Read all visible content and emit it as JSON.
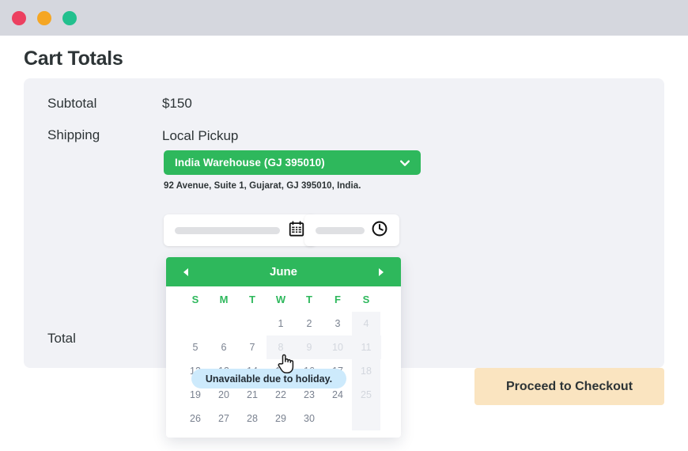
{
  "window": {
    "dots": [
      {
        "name": "close",
        "color": "#ec4060"
      },
      {
        "name": "minimize",
        "color": "#f5a623"
      },
      {
        "name": "maximize",
        "color": "#22c08e"
      }
    ]
  },
  "page": {
    "title": "Cart Totals"
  },
  "totals": {
    "subtotal_label": "Subtotal",
    "subtotal_value": "$150",
    "shipping_label": "Shipping",
    "shipping_method": "Local Pickup",
    "total_label": "Total"
  },
  "warehouse": {
    "selected": "India Warehouse (GJ 395010)",
    "chevron_icon": "chevron-down-icon",
    "address": "92 Avenue, Suite 1, Gujarat, GJ 395010, India.",
    "accent_color": "#2eb85c"
  },
  "fields": {
    "date": {
      "placeholder": "",
      "icon": "calendar-icon"
    },
    "time": {
      "placeholder": "",
      "icon": "clock-icon"
    }
  },
  "datepicker": {
    "month": "June",
    "prev_icon": "triangle-left-icon",
    "next_icon": "triangle-right-icon",
    "weekdays": [
      "S",
      "M",
      "T",
      "W",
      "T",
      "F",
      "S"
    ],
    "weeks": [
      [
        {
          "day": "",
          "state": "empty"
        },
        {
          "day": "",
          "state": "empty"
        },
        {
          "day": "",
          "state": "empty"
        },
        {
          "day": "1",
          "state": "available"
        },
        {
          "day": "2",
          "state": "available"
        },
        {
          "day": "3",
          "state": "available"
        },
        {
          "day": "4",
          "state": "disabled"
        }
      ],
      [
        {
          "day": "5",
          "state": "available"
        },
        {
          "day": "6",
          "state": "available"
        },
        {
          "day": "7",
          "state": "available"
        },
        {
          "day": "8",
          "state": "disabled"
        },
        {
          "day": "9",
          "state": "disabled"
        },
        {
          "day": "10",
          "state": "disabled"
        },
        {
          "day": "11",
          "state": "disabled"
        }
      ],
      [
        {
          "day": "12",
          "state": "available"
        },
        {
          "day": "13",
          "state": "available"
        },
        {
          "day": "14",
          "state": "available"
        },
        {
          "day": "15",
          "state": "available"
        },
        {
          "day": "16",
          "state": "available"
        },
        {
          "day": "17",
          "state": "available"
        },
        {
          "day": "18",
          "state": "disabled"
        }
      ],
      [
        {
          "day": "19",
          "state": "available"
        },
        {
          "day": "20",
          "state": "available"
        },
        {
          "day": "21",
          "state": "available"
        },
        {
          "day": "22",
          "state": "available"
        },
        {
          "day": "23",
          "state": "available"
        },
        {
          "day": "24",
          "state": "available"
        },
        {
          "day": "25",
          "state": "disabled"
        }
      ],
      [
        {
          "day": "26",
          "state": "available"
        },
        {
          "day": "27",
          "state": "available"
        },
        {
          "day": "28",
          "state": "available"
        },
        {
          "day": "29",
          "state": "available"
        },
        {
          "day": "30",
          "state": "available"
        },
        {
          "day": "",
          "state": "empty"
        },
        {
          "day": "",
          "state": "empty"
        }
      ]
    ],
    "header_color": "#2eb85c"
  },
  "tooltip": {
    "text": "Unavailable due to holiday.",
    "background": "#cdeafc"
  },
  "checkout": {
    "label": "Proceed to Checkout",
    "background": "#fae4c0"
  },
  "cursor": {
    "icon": "pointer-hand-cursor"
  }
}
